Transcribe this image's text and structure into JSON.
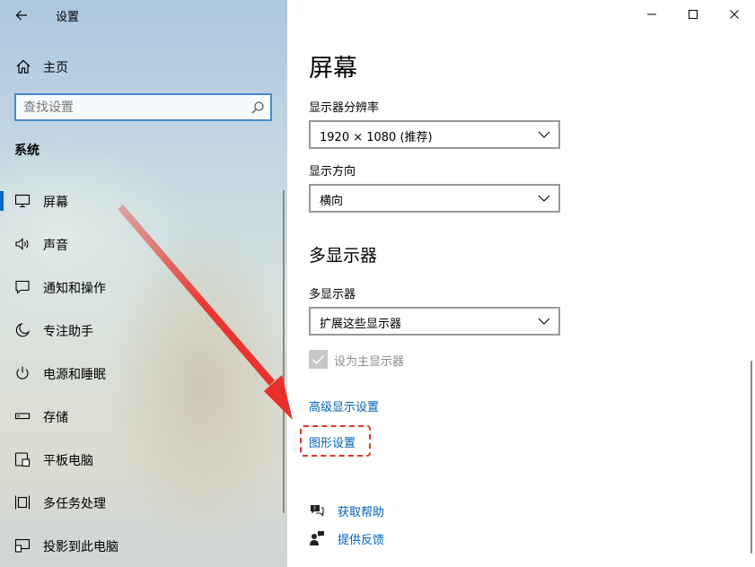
{
  "window": {
    "title": "设置",
    "controls": {
      "minimize": "minimize-icon",
      "maximize": "maximize-icon",
      "close": "close-icon"
    }
  },
  "nav": {
    "home_label": "主页",
    "search": {
      "placeholder": "查找设置",
      "value": ""
    },
    "section_title": "系统",
    "items": [
      {
        "label": "屏幕",
        "icon": "monitor-icon",
        "selected": true
      },
      {
        "label": "声音",
        "icon": "speaker-icon"
      },
      {
        "label": "通知和操作",
        "icon": "notification-icon"
      },
      {
        "label": "专注助手",
        "icon": "moon-icon"
      },
      {
        "label": "电源和睡眠",
        "icon": "power-icon"
      },
      {
        "label": "存储",
        "icon": "storage-icon"
      },
      {
        "label": "平板电脑",
        "icon": "tablet-icon"
      },
      {
        "label": "多任务处理",
        "icon": "multitask-icon"
      },
      {
        "label": "投影到此电脑",
        "icon": "project-icon"
      }
    ]
  },
  "content": {
    "page_title": "屏幕",
    "resolution": {
      "label": "显示器分辨率",
      "value": "1920 × 1080 (推荐)"
    },
    "orientation": {
      "label": "显示方向",
      "value": "横向"
    },
    "multi_display_heading": "多显示器",
    "multi_display": {
      "label": "多显示器",
      "value": "扩展这些显示器"
    },
    "main_display_checkbox": {
      "label": "设为主显示器",
      "checked": true,
      "disabled": true
    },
    "advanced_link": "高级显示设置",
    "graphics_link": "图形设置",
    "help": {
      "get_help": "获取帮助",
      "feedback": "提供反馈"
    }
  },
  "colors": {
    "accent": "#0067c0",
    "link": "#0062b8",
    "annotation": "#e8302a"
  }
}
